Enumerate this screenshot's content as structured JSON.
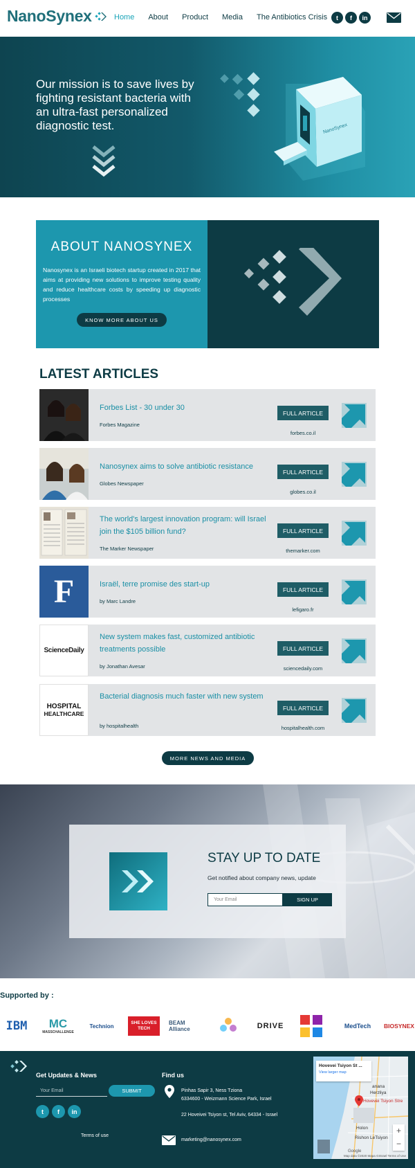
{
  "header": {
    "logo_text": "NanoSynex",
    "nav": [
      "Home",
      "About",
      "Product",
      "Media",
      "The Antibiotics Crisis"
    ],
    "social": [
      "twitter-icon",
      "facebook-icon",
      "linkedin-icon"
    ]
  },
  "hero": {
    "text": "Our mission is to save lives by fighting resistant bacteria with an ultra-fast personalized diagnostic test."
  },
  "about": {
    "title": "ABOUT NANOSYNEX",
    "description": "Nanosynex is an Israeli biotech startup created in 2017 that aims at providing new solutions to improve testing quality and reduce healthcare costs by speeding up diagnostic processes",
    "button": "KNOW MORE ABOUT US"
  },
  "articles": {
    "title": "LATEST ARTICLES",
    "button_label": "FULL ARTICLE",
    "items": [
      {
        "title": "Forbes List - 30 under 30",
        "source": "Forbes Magazine",
        "domain": "forbes.co.il"
      },
      {
        "title": "Nanosynex aims to solve antibiotic resistance",
        "source": "Globes Newspaper",
        "domain": "globes.co.il"
      },
      {
        "title": "The world's largest innovation program: will Israel join the $105 billion fund?",
        "source": "The Marker Newspaper",
        "domain": "themarker.com"
      },
      {
        "title": "Israël, terre promise des start-up",
        "source": "by Marc Landre",
        "domain": "lefigaro.fr"
      },
      {
        "title": "New system makes fast, customized antibiotic treatments possible",
        "source": "by Jonathan Avesar",
        "domain": "sciencedaily.com"
      },
      {
        "title": "Bacterial diagnosis much faster with new system",
        "source": "by hospitalhealth",
        "domain": "hospitalhealth.com"
      }
    ],
    "thumb_texts": [
      "F",
      "ScienceDaily",
      "HOSPITAL",
      "HEALTHCARE"
    ],
    "more_button": "MORE NEWS AND MEDIA"
  },
  "newsletter": {
    "title": "STAY UP TO DATE",
    "subtitle": "Get notified about company news, update",
    "email_placeholder": "Your Email",
    "button": "SIGN UP"
  },
  "supported": {
    "title": "Supported by :",
    "sponsors": [
      "IBM",
      "MC",
      "MASSCHALLENGE",
      "Technion",
      "SHE LOVES TECH",
      "BEAM Alliance",
      "DRIVE",
      "MedTech",
      "BIOSYNEX"
    ]
  },
  "footer": {
    "updates_title": "Get Updates & News",
    "email_placeholder": "Your Email",
    "submit": "SUBMIT",
    "terms": "Terms of use",
    "find_us_title": "Find us",
    "address1_line1": "Pinhas Sapir 3, Ness Tziona",
    "address1_line2": "6334600 - Weizmann Science Park, Israel",
    "address2": "22 Hoveivei Tsiyon st, Tel Aviv, 64334 - Israel",
    "email": "marketing@nanosynex.com",
    "map": {
      "card_title": "Hovevei Tsiyon St ...",
      "card_link": "View larger map",
      "labels": [
        "Herzliya",
        "Hovevei Tsiyon Stre",
        "Holon",
        "Rishon LeTsiyon",
        "anana"
      ],
      "footer_text": "Map data ©2020 Mapa GISrael  Terms of Use",
      "google": "Google"
    }
  },
  "colors": {
    "dark_teal": "#0d3b44",
    "accent": "#1d97ae",
    "link": "#1a8fa5"
  }
}
